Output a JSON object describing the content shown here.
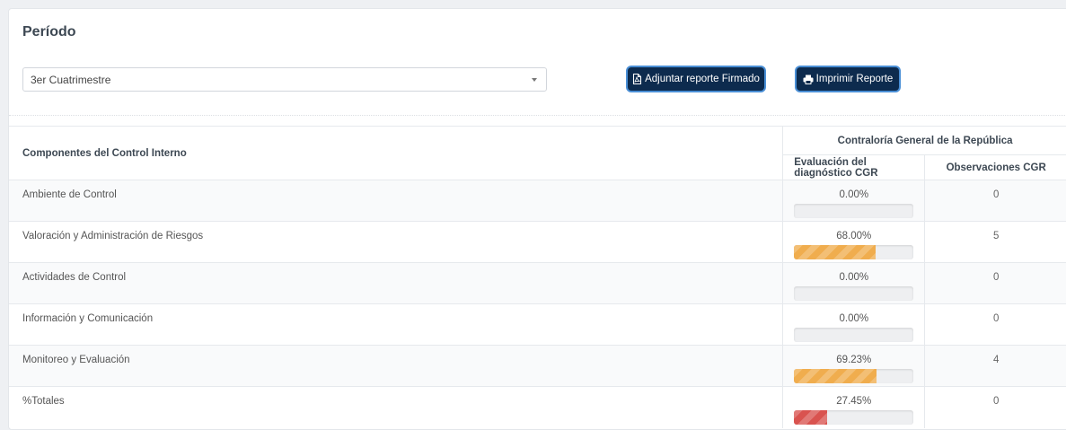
{
  "period": {
    "title": "Período",
    "selected": "3er Cuatrimestre"
  },
  "buttons": {
    "attach_label": "Adjuntar reporte Firmado",
    "print_label": "Imprimir Reporte"
  },
  "table": {
    "col_component": "Componentes del Control Interno",
    "group_header": "Contraloría General de la República",
    "col_eval": "Evaluación del diagnóstico CGR",
    "col_obs": "Observaciones CGR",
    "rows": [
      {
        "component": "Ambiente de Control",
        "percent_text": "0.00%",
        "percent": 0,
        "observations": "0",
        "bar_color": "#f0ad4e"
      },
      {
        "component": "Valoración y Administración de Riesgos",
        "percent_text": "68.00%",
        "percent": 68.0,
        "observations": "5",
        "bar_color": "#f0ad4e"
      },
      {
        "component": "Actividades de Control",
        "percent_text": "0.00%",
        "percent": 0,
        "observations": "0",
        "bar_color": "#f0ad4e"
      },
      {
        "component": "Información y Comunicación",
        "percent_text": "0.00%",
        "percent": 0,
        "observations": "0",
        "bar_color": "#f0ad4e"
      },
      {
        "component": "Monitoreo y Evaluación",
        "percent_text": "69.23%",
        "percent": 69.23,
        "observations": "4",
        "bar_color": "#f0ad4e"
      },
      {
        "component": "%Totales",
        "percent_text": "27.45%",
        "percent": 27.45,
        "observations": "0",
        "bar_color": "#d9534f"
      }
    ]
  }
}
